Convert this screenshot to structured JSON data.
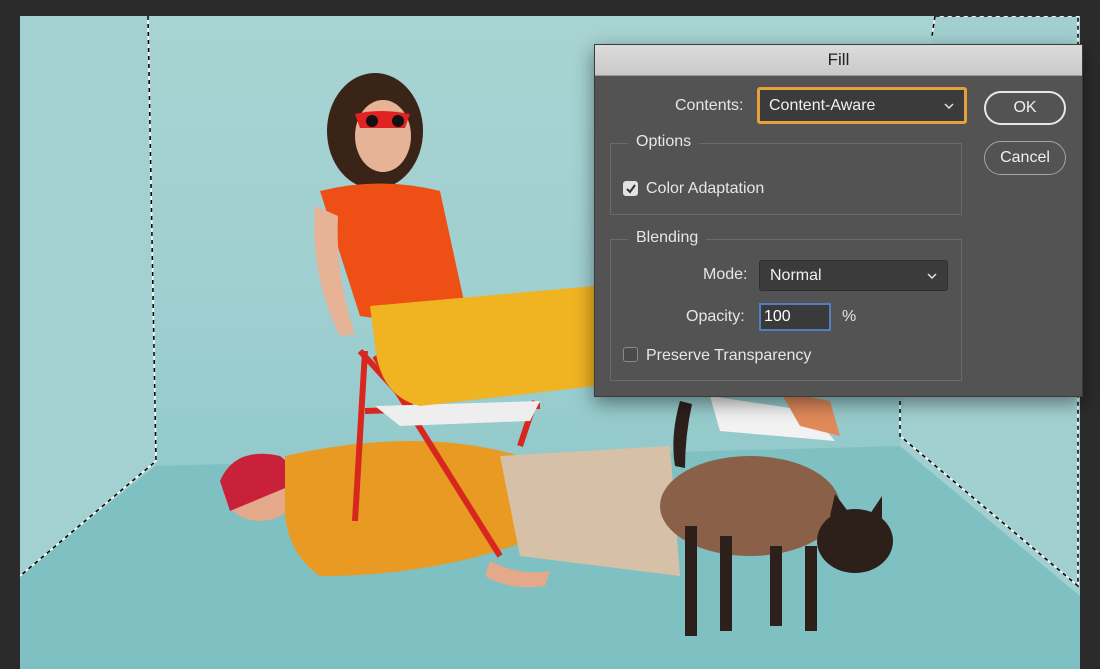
{
  "dialog": {
    "title": "Fill",
    "contents_label": "Contents:",
    "contents_value": "Content-Aware",
    "ok_label": "OK",
    "cancel_label": "Cancel",
    "options": {
      "title": "Options",
      "color_adaptation_label": "Color Adaptation",
      "color_adaptation_checked": true
    },
    "blending": {
      "title": "Blending",
      "mode_label": "Mode:",
      "mode_value": "Normal",
      "opacity_label": "Opacity:",
      "opacity_value": "100",
      "opacity_unit": "%",
      "preserve_transparency_label": "Preserve Transparency",
      "preserve_transparency_checked": false
    }
  },
  "colors": {
    "app_background": "#2b2b2b",
    "backdrop": "#a6d2d2",
    "dialog_bg": "#535353",
    "title_bar": "#d4d4d4",
    "focus_ring": "#e5a13a",
    "input_focus": "#4f7fbf"
  },
  "icons": {
    "dropdown": "chevron-down-icon",
    "check": "checkmark-icon"
  }
}
